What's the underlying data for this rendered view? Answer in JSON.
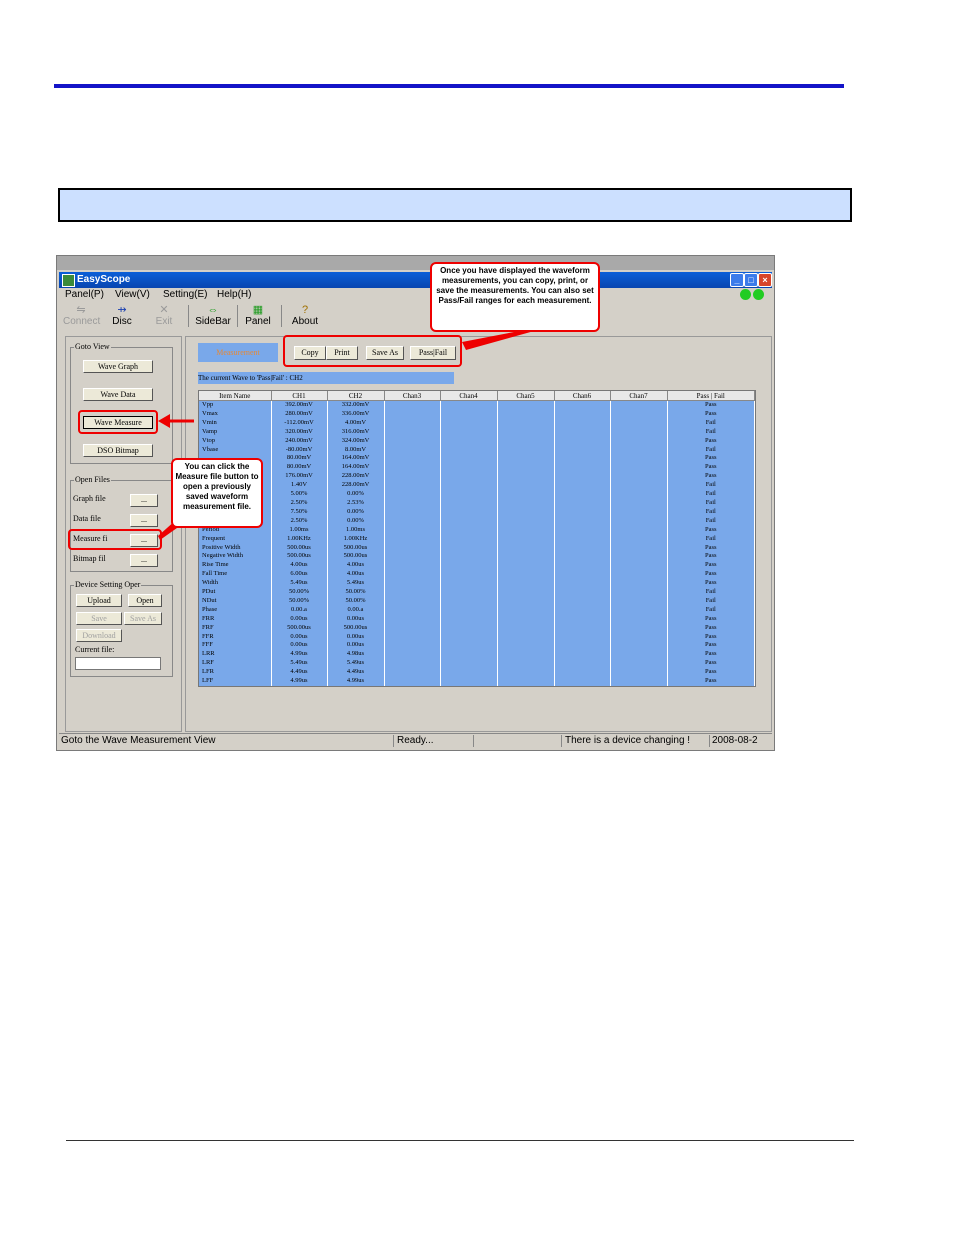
{
  "app": {
    "title": "EasyScope"
  },
  "menu": [
    "Panel(P)",
    "View(V)",
    "Setting(E)",
    "Help(H)"
  ],
  "toolbar": {
    "connect": "Connect",
    "disc": "Disc",
    "exit": "Exit",
    "sidebar": "SideBar",
    "panel": "Panel",
    "about": "About"
  },
  "goto_view": {
    "title": "Goto View",
    "wave_graph": "Wave Graph",
    "wave_data": "Wave Data",
    "wave_measure": "Wave Measure",
    "dso_bitmap": "DSO Bitmap"
  },
  "open_files": {
    "title": "Open Files",
    "graph_file": "Graph file",
    "data_file": "Data file",
    "measure_file": "Measure fi",
    "bitmap_file": "Bitmap fil",
    "browse": "..."
  },
  "device_setting": {
    "title": "Device Setting Oper",
    "upload": "Upload",
    "open": "Open",
    "save": "Save",
    "save_as": "Save As",
    "download": "Download",
    "current_file": "Current file:"
  },
  "measurement": {
    "tab": "Measurement",
    "copy": "Copy",
    "print": "Print",
    "save_as": "Save As",
    "pass_fail": "Pass|Fail",
    "caption": "The current Wave to 'Pass|Fail' :  CH2",
    "columns": [
      "Item Name",
      "CH1",
      "CH2",
      "Chan3",
      "Chan4",
      "Chan5",
      "Chan6",
      "Chan7",
      "Pass | Fail"
    ],
    "rows": [
      [
        "Vpp",
        "392.00mV",
        "332.00mV",
        "Pass"
      ],
      [
        "Vmax",
        "280.00mV",
        "336.00mV",
        "Pass"
      ],
      [
        "Vmin",
        "-112.00mV",
        "4.00mV",
        "Fail"
      ],
      [
        "Vamp",
        "320.00mV",
        "316.00mV",
        "Fail"
      ],
      [
        "Vtop",
        "240.00mV",
        "324.00mV",
        "Pass"
      ],
      [
        "Vbase",
        "-80.00mV",
        "8.00mV",
        "Fail"
      ],
      [
        "",
        "80.00mV",
        "164.00mV",
        "Pass"
      ],
      [
        "",
        "80.00mV",
        "164.00mV",
        "Pass"
      ],
      [
        "",
        "176.00mV",
        "228.00mV",
        "Pass"
      ],
      [
        "",
        "1.40V",
        "228.00mV",
        "Fail"
      ],
      [
        "",
        "5.00%",
        "0.00%",
        "Fail"
      ],
      [
        "",
        "2.50%",
        "2.53%",
        "Fail"
      ],
      [
        "",
        "7.50%",
        "0.00%",
        "Fail"
      ],
      [
        "",
        "2.50%",
        "0.00%",
        "Fail"
      ],
      [
        "Period",
        "1.00ms",
        "1.00ms",
        "Pass"
      ],
      [
        "Frequent",
        "1.00KHz",
        "1.00KHz",
        "Fail"
      ],
      [
        "Positive Width",
        "500.00us",
        "500.00us",
        "Pass"
      ],
      [
        "Negative Width",
        "500.00us",
        "500.00us",
        "Pass"
      ],
      [
        "Rise Time",
        "4.00us",
        "4.00us",
        "Pass"
      ],
      [
        "Fall Time",
        "6.00us",
        "4.00us",
        "Pass"
      ],
      [
        "Width",
        "5.49us",
        "5.49us",
        "Pass"
      ],
      [
        "PDut",
        "50.00%",
        "50.00%",
        "Fail"
      ],
      [
        "NDut",
        "50.00%",
        "50.00%",
        "Fail"
      ],
      [
        "Phase",
        "0.00.a",
        "0.00.a",
        "Fail"
      ],
      [
        "FRR",
        "0.00us",
        "0.00us",
        "Pass"
      ],
      [
        "FRF",
        "500.00us",
        "500.00us",
        "Pass"
      ],
      [
        "FFR",
        "0.00us",
        "0.00us",
        "Pass"
      ],
      [
        "FFF",
        "0.00us",
        "0.00us",
        "Pass"
      ],
      [
        "LRR",
        "4.99us",
        "4.98us",
        "Pass"
      ],
      [
        "LRF",
        "5.49us",
        "5.49us",
        "Pass"
      ],
      [
        "LFR",
        "4.49us",
        "4.49us",
        "Pass"
      ],
      [
        "LFF",
        "4.99us",
        "4.99us",
        "Pass"
      ]
    ]
  },
  "status": {
    "left": "Goto the Wave Measurement View",
    "ready": "Ready...",
    "msg": "There is a device changing !",
    "date": "2008-08-2"
  },
  "callouts": {
    "top": "Once you have displayed the waveform measurements, you can copy, print, or save the measurements. You can also set Pass/Fail ranges for each measurement.",
    "left": "You can click the Measure file button to open a previously saved waveform measurement file."
  }
}
